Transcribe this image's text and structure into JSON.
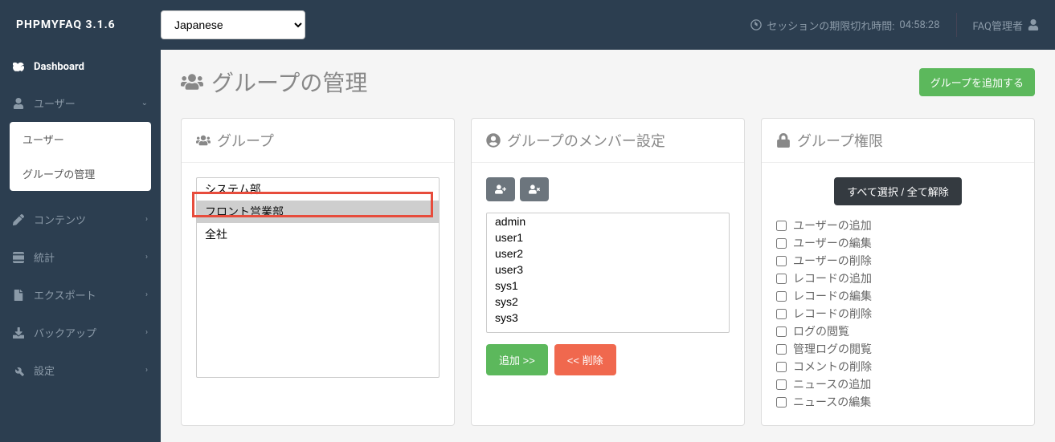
{
  "header": {
    "logo": "PHPMYFAQ 3.1.6",
    "language": "Japanese",
    "session_label": "セッションの期限切れ時間:",
    "session_time": "04:58:28",
    "user": "FAQ管理者"
  },
  "sidebar": {
    "dashboard": "Dashboard",
    "items": [
      {
        "label": "ユーザー",
        "expanded": true,
        "children": [
          "ユーザー",
          "グループの管理"
        ]
      },
      {
        "label": "コンテンツ"
      },
      {
        "label": "統計"
      },
      {
        "label": "エクスポート"
      },
      {
        "label": "バックアップ"
      },
      {
        "label": "設定"
      }
    ]
  },
  "page": {
    "title": "グループの管理",
    "add_button": "グループを追加する"
  },
  "groups_card": {
    "title": "グループ",
    "items": [
      "システム部",
      "フロント営業部",
      "全社"
    ],
    "selected": "フロント営業部"
  },
  "members_card": {
    "title": "グループのメンバー設定",
    "list": [
      "admin",
      "user1",
      "user2",
      "user3",
      "sys1",
      "sys2",
      "sys3"
    ],
    "add_button": "追加 >>",
    "remove_button": "<< 削除"
  },
  "permissions_card": {
    "title": "グループ権限",
    "toggle_button": "すべて選択 / 全て解除",
    "items": [
      "ユーザーの追加",
      "ユーザーの編集",
      "ユーザーの削除",
      "レコードの追加",
      "レコードの編集",
      "レコードの削除",
      "ログの閲覧",
      "管理ログの閲覧",
      "コメントの削除",
      "ニュースの追加",
      "ニュースの編集"
    ]
  }
}
